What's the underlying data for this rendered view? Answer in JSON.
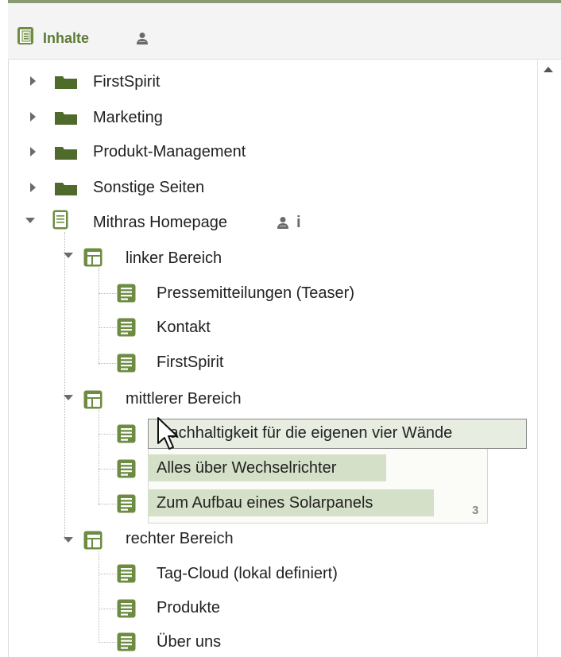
{
  "header": {
    "title": "Inhalte"
  },
  "tree": {
    "folders": [
      {
        "label": "FirstSpirit"
      },
      {
        "label": "Marketing"
      },
      {
        "label": "Produkt-Management"
      },
      {
        "label": "Sonstige Seiten"
      }
    ],
    "page": {
      "label": "Mithras Homepage",
      "info_glyph": "i",
      "sections": [
        {
          "label": "linker Bereich",
          "items": [
            "Pressemitteilungen (Teaser)",
            "Kontakt",
            "FirstSpirit"
          ]
        },
        {
          "label": "mittlerer Bereich",
          "items": [
            "Nachhaltigkeit für die eigenen vier Wände",
            "Alles über Wechselrichter",
            "Zum Aufbau eines Solarpanels"
          ]
        },
        {
          "label": "rechter Bereich",
          "items": [
            "Tag-Cloud (lokal definiert)",
            "Produkte",
            "Über uns"
          ]
        }
      ]
    }
  },
  "drag": {
    "label": "Nachhaltigkeit für die eigenen vier Wände",
    "count": "3"
  },
  "colors": {
    "accent": "#5e7b35",
    "folder": "#4f6b2c",
    "highlight": "#d5e0c8"
  },
  "icons": {
    "header": "content-store-icon",
    "user": "user-icon",
    "folder": "folder-icon",
    "page": "page-icon",
    "section": "section-icon",
    "paragraph": "paragraph-icon",
    "cursor": "mouse-cursor-icon"
  }
}
